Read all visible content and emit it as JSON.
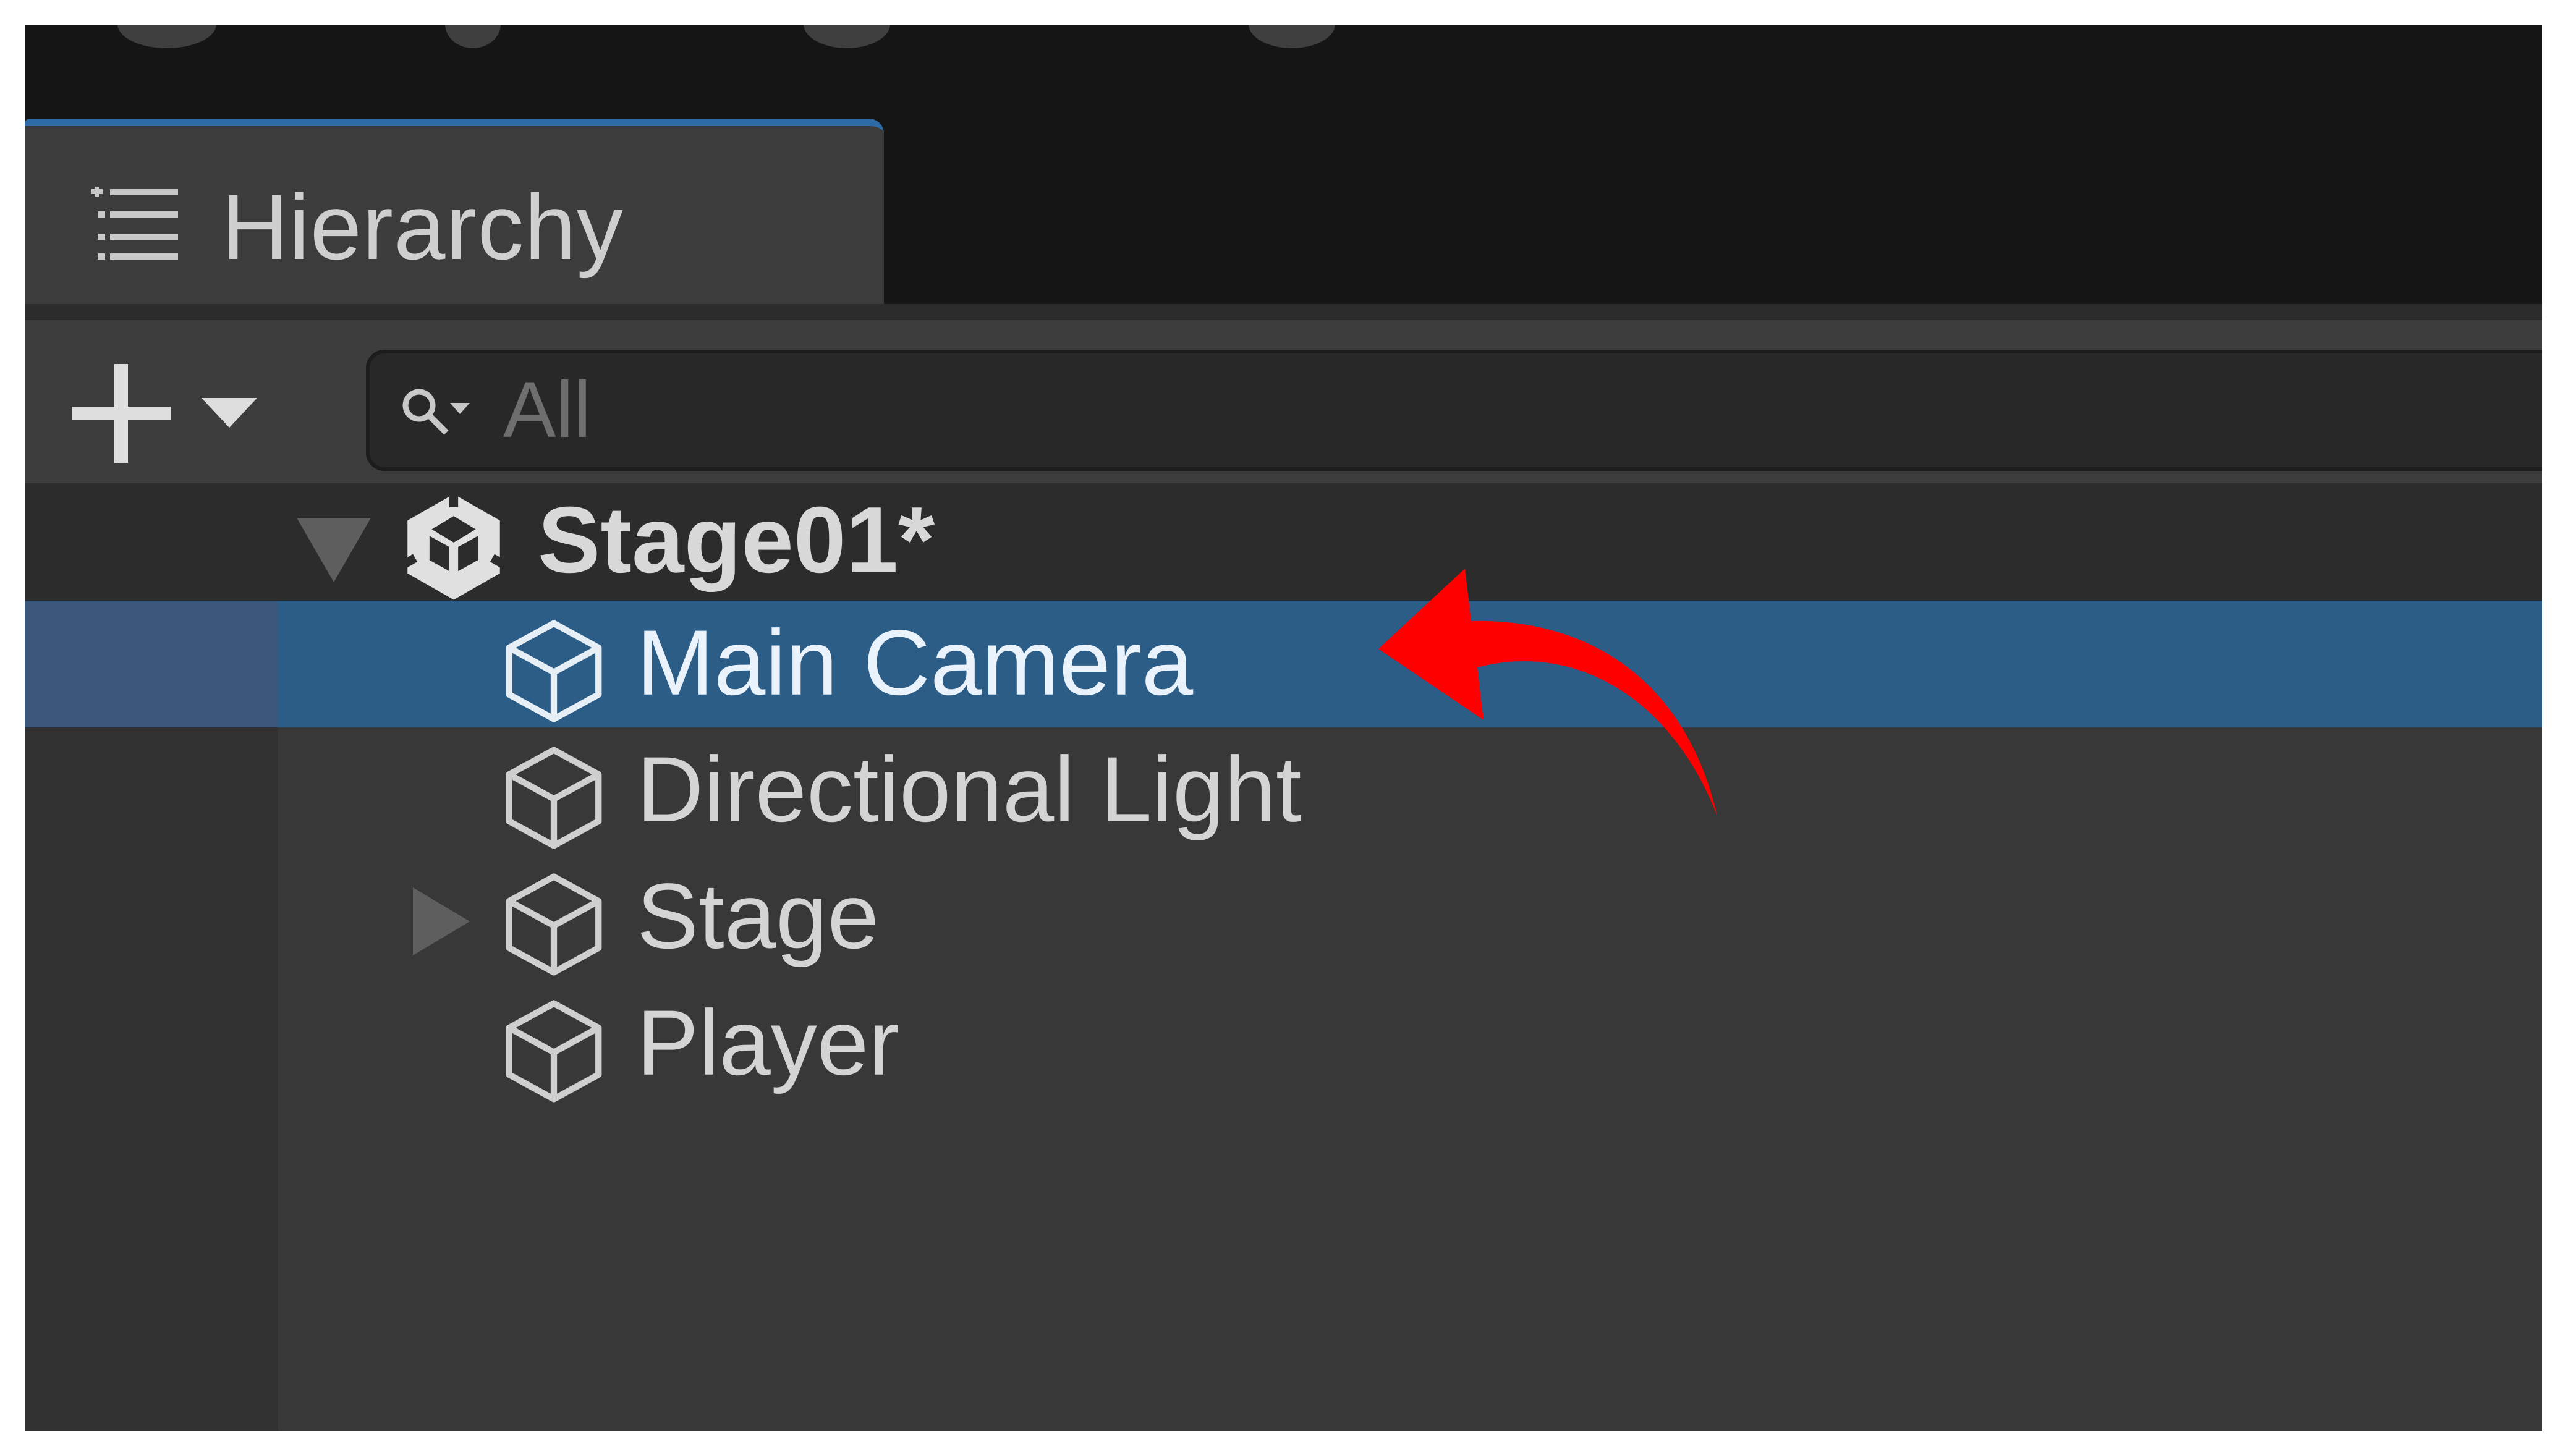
{
  "window": {
    "tab_title": "Hierarchy",
    "tab_icon": "hierarchy-list-icon"
  },
  "toolbar": {
    "add_icon": "plus-icon",
    "dropdown_icon": "caret-down-icon",
    "search_icon": "search-dropdown-icon",
    "search_placeholder": "All",
    "search_value": ""
  },
  "hierarchy": {
    "scene": {
      "name": "Stage01*",
      "icon": "unity-scene-icon",
      "expanded": true
    },
    "items": [
      {
        "label": "Main Camera",
        "icon": "gameobject-cube-icon",
        "selected": true,
        "has_children": false
      },
      {
        "label": "Directional Light",
        "icon": "gameobject-cube-icon",
        "selected": false,
        "has_children": false
      },
      {
        "label": "Stage",
        "icon": "gameobject-cube-icon",
        "selected": false,
        "has_children": true,
        "expanded": false
      },
      {
        "label": "Player",
        "icon": "gameobject-cube-icon",
        "selected": false,
        "has_children": false
      }
    ]
  },
  "annotation": {
    "icon": "curved-pointer-arrow-icon",
    "color": "#ff0000",
    "points_to": "Main Camera"
  },
  "colors": {
    "background": "#383838",
    "titlebar": "#151515",
    "selection": "#2c5d87",
    "tab_accent": "#2d6aa8"
  }
}
